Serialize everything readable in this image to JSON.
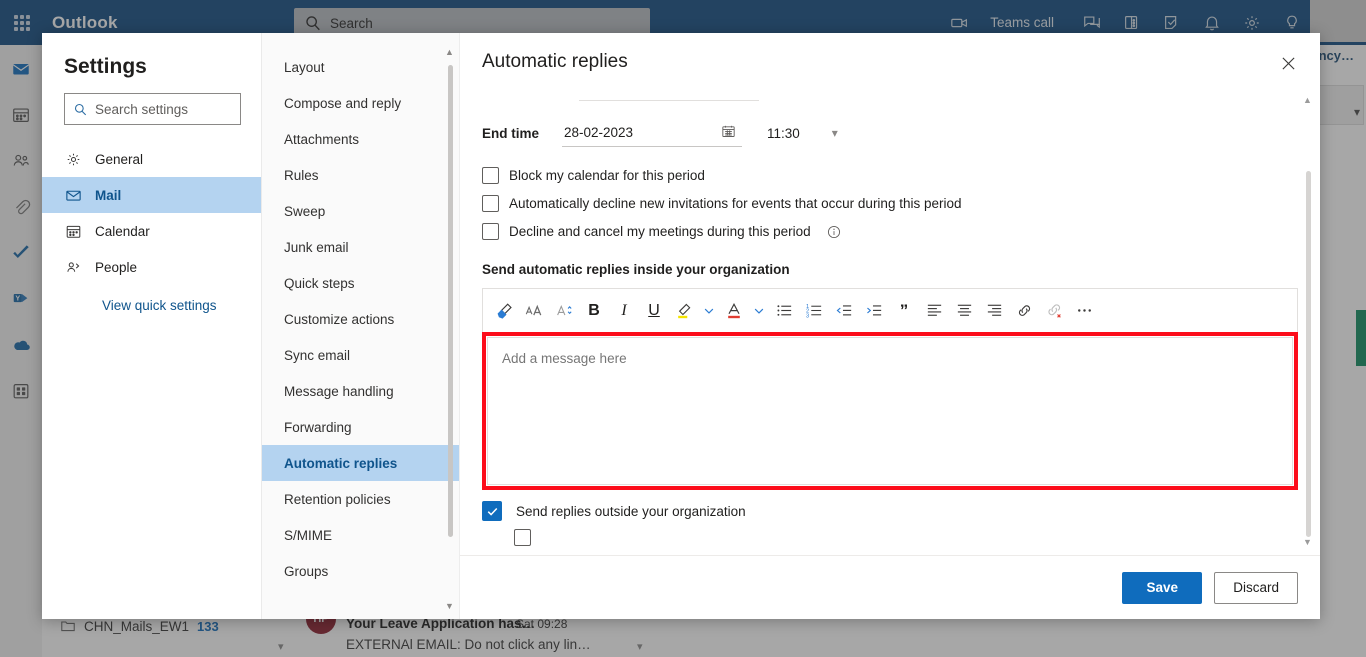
{
  "topbar": {
    "waffle_label": "app-launcher",
    "brand": "Outlook",
    "search_placeholder": "Search",
    "teams_call_label": "Teams call",
    "icons": [
      "video-camera-icon",
      "chat-icon",
      "meet-now-icon",
      "tasks-icon",
      "bell-icon",
      "gear-icon",
      "lightbulb-icon"
    ]
  },
  "rail": {
    "items": [
      {
        "name": "mail-icon",
        "label": "Mail",
        "active": true
      },
      {
        "name": "calendar-icon",
        "label": "Calendar",
        "active": false
      },
      {
        "name": "people-icon",
        "label": "People",
        "active": false
      },
      {
        "name": "attachments-icon",
        "label": "Files",
        "active": false
      },
      {
        "name": "todo-icon",
        "label": "To Do",
        "active": false
      },
      {
        "name": "yammer-icon",
        "label": "Yammer",
        "active": false
      },
      {
        "name": "onedrive-icon",
        "label": "OneDrive",
        "active": false
      },
      {
        "name": "apps-icon",
        "label": "Apps",
        "active": false
      }
    ]
  },
  "background": {
    "folder_name": "CHN_Mails_EW1",
    "folder_count": "133",
    "message_sender_initials": "HP",
    "message_subject": "Your Leave Application has…",
    "message_time": "Sat 09:28",
    "message_preview": "EXTERNAl EMAIL: Do not click any lin…",
    "right_cut_text": "ncy…"
  },
  "settings": {
    "title": "Settings",
    "search_placeholder": "Search settings",
    "nav_items": [
      {
        "label": "General",
        "icon": "gear-icon",
        "selected": false
      },
      {
        "label": "Mail",
        "icon": "mail-icon",
        "selected": true
      },
      {
        "label": "Calendar",
        "icon": "calendar-icon",
        "selected": false
      },
      {
        "label": "People",
        "icon": "people-icon",
        "selected": false
      }
    ],
    "quick_settings_link": "View quick settings",
    "categories": [
      {
        "label": "Layout",
        "selected": false
      },
      {
        "label": "Compose and reply",
        "selected": false
      },
      {
        "label": "Attachments",
        "selected": false
      },
      {
        "label": "Rules",
        "selected": false
      },
      {
        "label": "Sweep",
        "selected": false
      },
      {
        "label": "Junk email",
        "selected": false
      },
      {
        "label": "Quick steps",
        "selected": false
      },
      {
        "label": "Customize actions",
        "selected": false
      },
      {
        "label": "Sync email",
        "selected": false
      },
      {
        "label": "Message handling",
        "selected": false
      },
      {
        "label": "Forwarding",
        "selected": false
      },
      {
        "label": "Automatic replies",
        "selected": true
      },
      {
        "label": "Retention policies",
        "selected": false
      },
      {
        "label": "S/MIME",
        "selected": false
      },
      {
        "label": "Groups",
        "selected": false
      }
    ]
  },
  "panel": {
    "title": "Automatic replies",
    "close_label": "Close",
    "end_time_label": "End time",
    "end_date_value": "28-02-2023",
    "end_time_value": "11:30",
    "checkboxes": [
      {
        "label": "Block my calendar for this period",
        "checked": false,
        "info": false
      },
      {
        "label": "Automatically decline new invitations for events that occur during this period",
        "checked": false,
        "info": false
      },
      {
        "label": "Decline and cancel my meetings during this period",
        "checked": false,
        "info": true
      }
    ],
    "section_label": "Send automatic replies inside your organization",
    "toolbar_buttons": [
      {
        "name": "format-painter-icon",
        "label": "Format painter"
      },
      {
        "name": "font-size-grow-icon",
        "label": "Increase font size"
      },
      {
        "name": "font-size-shrink-icon",
        "label": "Font size"
      },
      {
        "name": "bold-icon",
        "label": "B"
      },
      {
        "name": "italic-icon",
        "label": "I"
      },
      {
        "name": "underline-icon",
        "label": "U"
      },
      {
        "name": "highlight-color-icon",
        "label": "Highlight"
      },
      {
        "name": "highlight-chevron-down-icon",
        "label": "Highlight options"
      },
      {
        "name": "font-color-icon",
        "label": "Font color"
      },
      {
        "name": "font-color-chevron-down-icon",
        "label": "Font color options"
      },
      {
        "name": "bulleted-list-icon",
        "label": "Bulleted list"
      },
      {
        "name": "numbered-list-icon",
        "label": "Numbered list"
      },
      {
        "name": "decrease-indent-icon",
        "label": "Decrease indent"
      },
      {
        "name": "increase-indent-icon",
        "label": "Increase indent"
      },
      {
        "name": "quote-icon",
        "label": "Quote"
      },
      {
        "name": "align-left-icon",
        "label": "Align left"
      },
      {
        "name": "align-center-icon",
        "label": "Align center"
      },
      {
        "name": "align-right-icon",
        "label": "Align right"
      },
      {
        "name": "insert-link-icon",
        "label": "Insert link"
      },
      {
        "name": "remove-link-icon",
        "label": "Remove link"
      },
      {
        "name": "more-options-icon",
        "label": "More options"
      }
    ],
    "message_placeholder": "Add a message here",
    "outside_checkbox_label": "Send replies outside your organization",
    "outside_checkbox_checked": true,
    "save_label": "Save",
    "discard_label": "Discard"
  },
  "colors": {
    "brand_navy": "#0f4a80",
    "accent_blue": "#0f6cbd",
    "selected_blue": "#b4d3f0",
    "highlight_red": "#fc0d1b",
    "link_blue": "#0f548c"
  }
}
